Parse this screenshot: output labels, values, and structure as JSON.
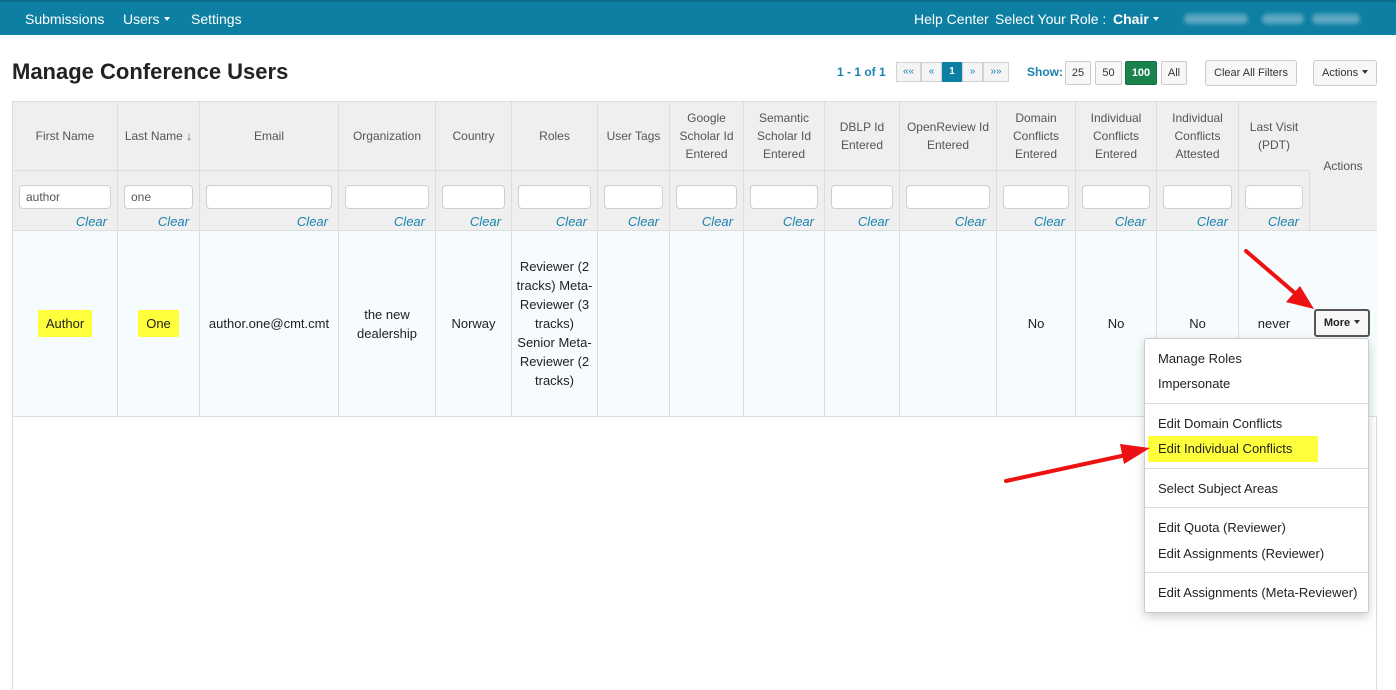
{
  "nav": {
    "submissions": "Submissions",
    "users": "Users",
    "settings": "Settings",
    "help_center": "Help Center",
    "select_role_label": "Select Your Role :",
    "role": "Chair"
  },
  "page": {
    "title": "Manage Conference Users"
  },
  "pager": {
    "info": "1 - 1 of 1",
    "first": "««",
    "prev": "«",
    "current": "1",
    "next": "»",
    "last": "»»"
  },
  "show": {
    "label": "Show:",
    "options": [
      "25",
      "50",
      "100",
      "All"
    ],
    "selected": "100"
  },
  "toolbar": {
    "clear_filters": "Clear All Filters",
    "actions": "Actions"
  },
  "table": {
    "headers": [
      "First Name",
      "Last Name ↓",
      "Email",
      "Organization",
      "Country",
      "Roles",
      "User Tags",
      "Google Scholar Id Entered",
      "Semantic Scholar Id Entered",
      "DBLP Id Entered",
      "OpenReview Id Entered",
      "Domain Conflicts Entered",
      "Individual Conflicts Entered",
      "Individual Conflicts Attested",
      "Last Visit (PDT)",
      "Actions"
    ],
    "filters": [
      "author",
      "one",
      "",
      "",
      "",
      "",
      "",
      "",
      "",
      "",
      "",
      "",
      "",
      "",
      ""
    ],
    "clear_label": "Clear",
    "row": {
      "first_name": "Author",
      "last_name": "One",
      "email": "author.one@cmt.cmt",
      "organization": "the new dealership",
      "country": "Norway",
      "roles": "Reviewer (2 tracks) Meta-Reviewer (3 tracks) Senior Meta-Reviewer (2 tracks)",
      "user_tags": "",
      "google_scholar": "",
      "semantic_scholar": "",
      "dblp": "",
      "openreview": "",
      "domain_conflicts": "No",
      "individual_conflicts": "No",
      "individual_attested": "No",
      "last_visit": "never",
      "more": "More"
    }
  },
  "menu": {
    "manage_roles": "Manage Roles",
    "impersonate": "Impersonate",
    "edit_domain_conflicts": "Edit Domain Conflicts",
    "edit_individual_conflicts": "Edit Individual Conflicts",
    "select_subject_areas": "Select Subject Areas",
    "edit_quota_reviewer": "Edit Quota (Reviewer)",
    "edit_assignments_reviewer": "Edit Assignments (Reviewer)",
    "edit_assignments_meta": "Edit Assignments (Meta-Reviewer)"
  },
  "colors": {
    "navbar": "#0d7fa2",
    "link": "#1a84b0",
    "highlight": "#ffff3b",
    "selected_size": "#19834e",
    "annotation_arrow": "#ee1111"
  }
}
